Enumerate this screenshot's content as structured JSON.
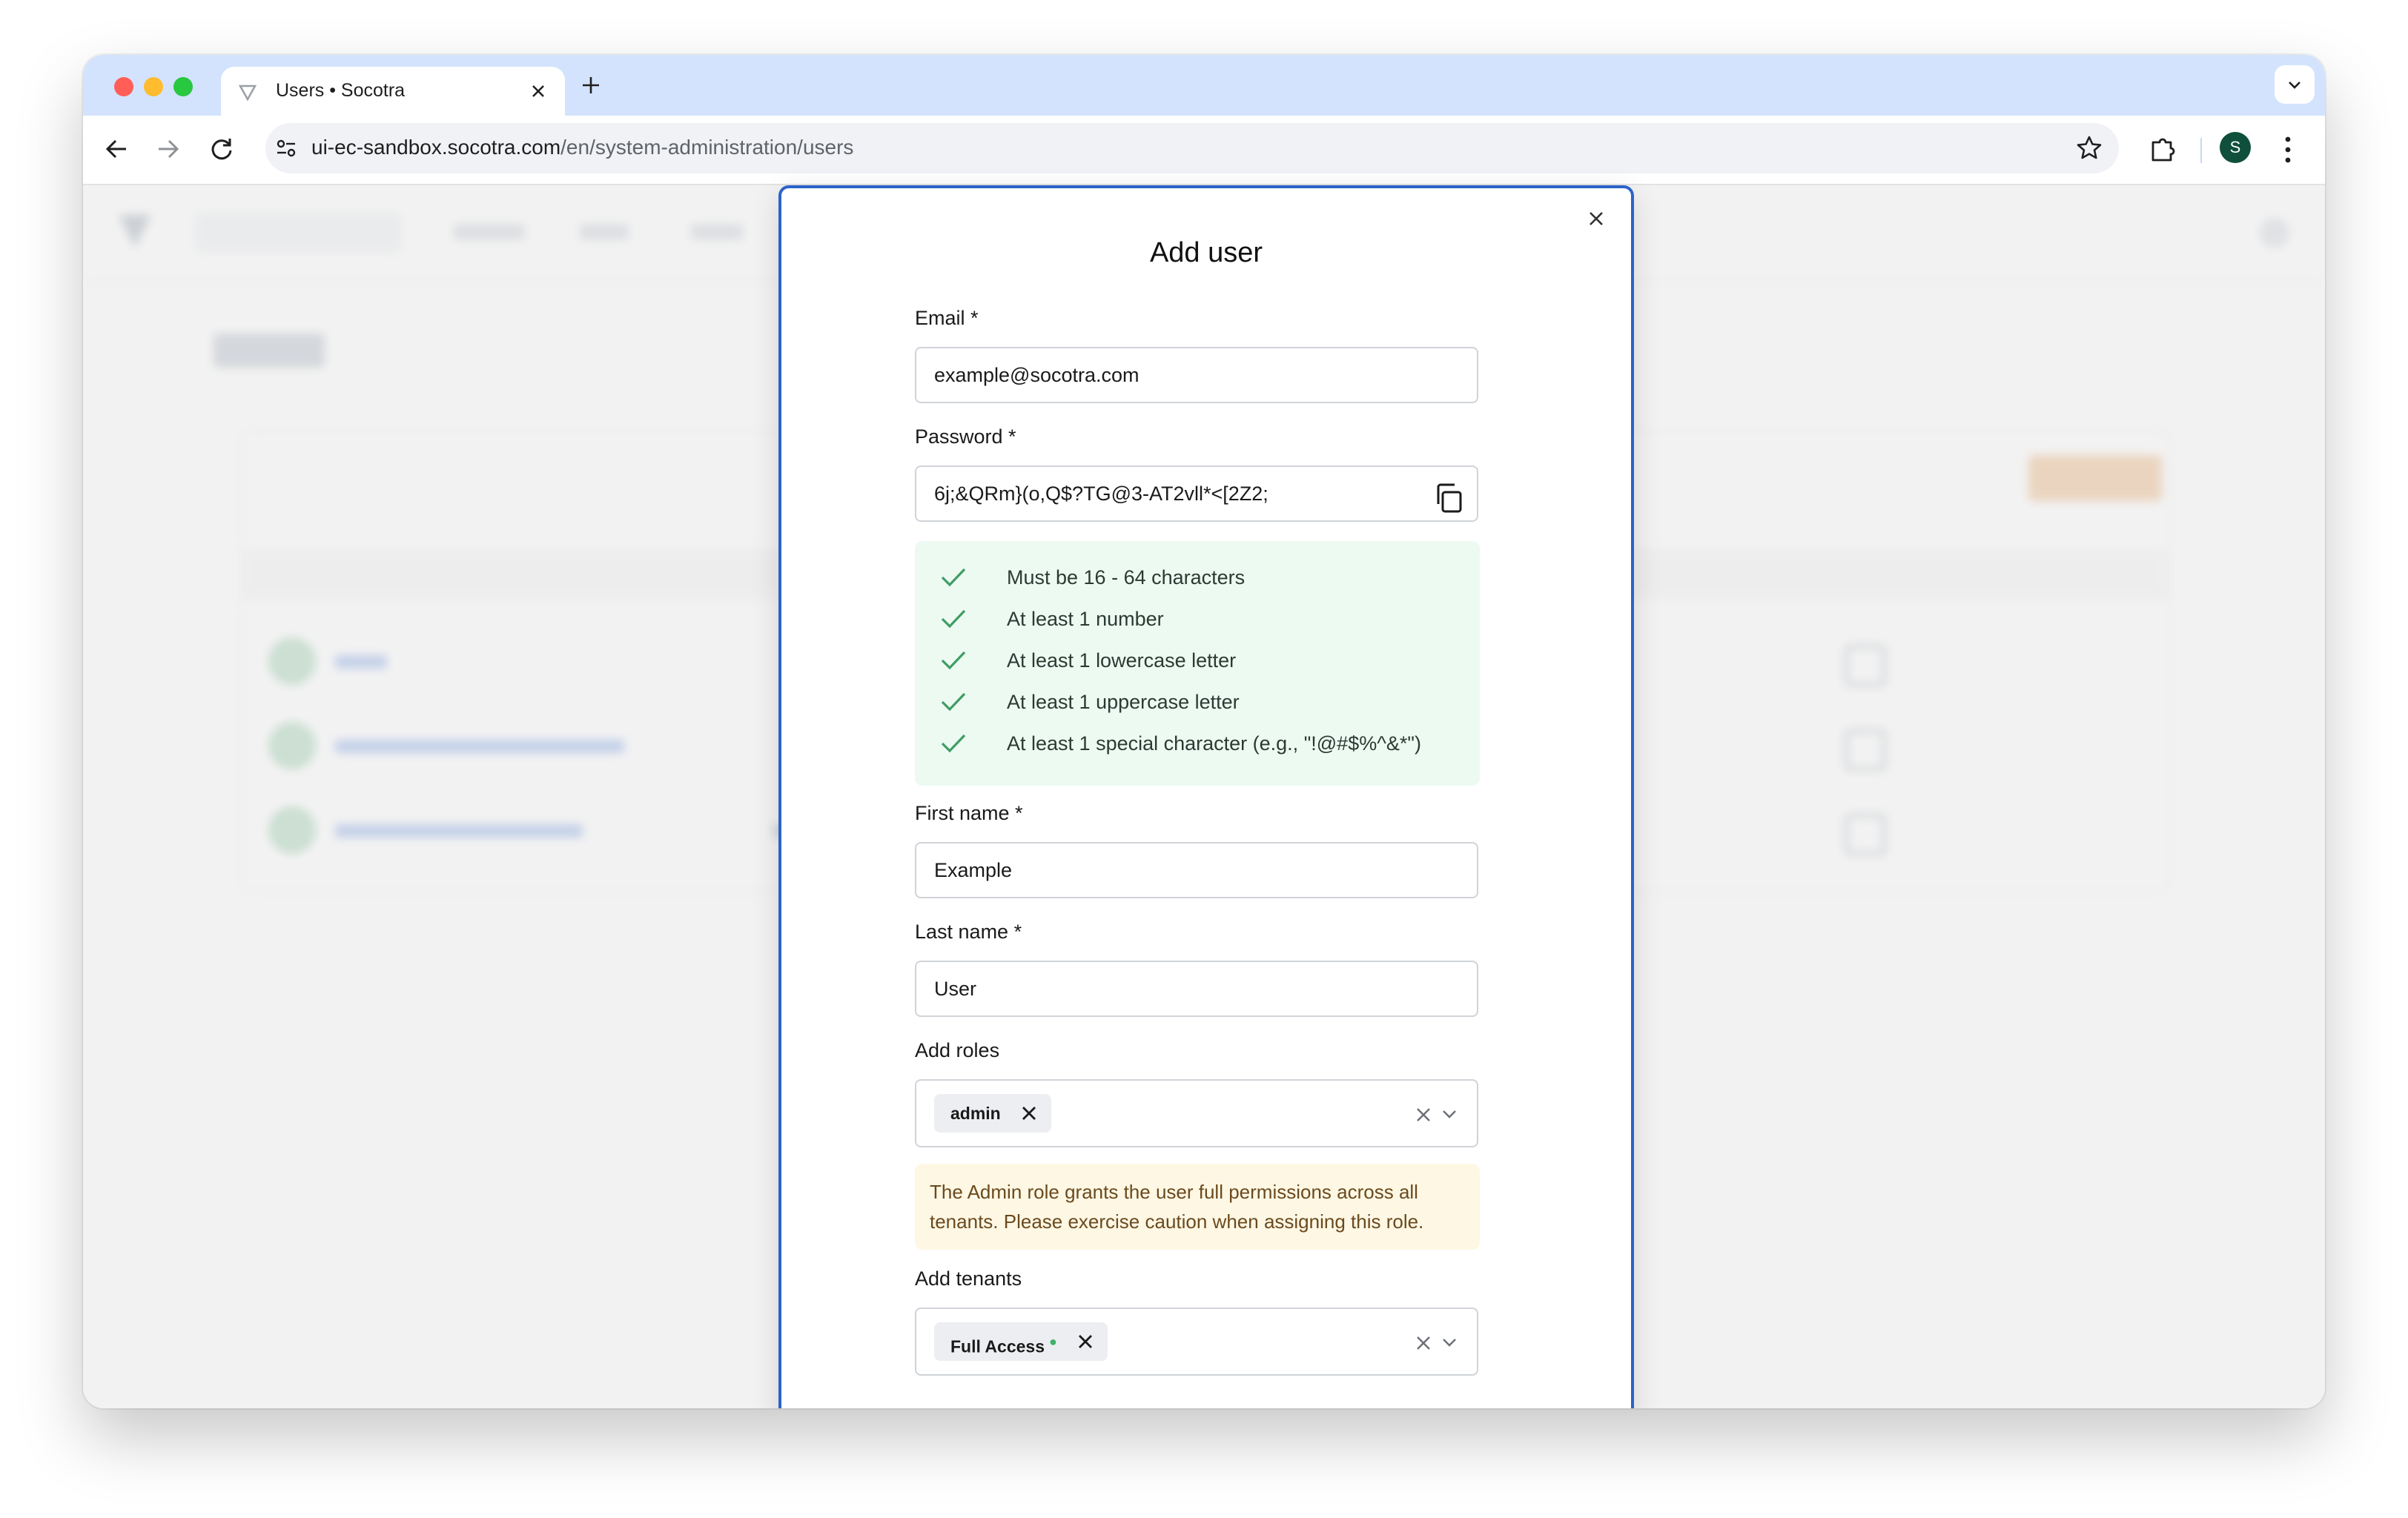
{
  "browser": {
    "tab_title": "Users • Socotra",
    "url_host": "ui-ec-sandbox.socotra.com",
    "url_path": "/en/system-administration/users",
    "profile_initial": "S"
  },
  "modal": {
    "title": "Add user",
    "email": {
      "label": "Email *",
      "value": "example@socotra.com"
    },
    "password": {
      "label": "Password *",
      "value": "6j;&QRm}(o,Q$?TG@3-AT2vll*<[2Z2;"
    },
    "password_rules": [
      "Must be 16 - 64 characters",
      "At least 1 number",
      "At least 1 lowercase letter",
      "At least 1 uppercase letter",
      "At least 1 special character (e.g., \"!@#$%^&*\")"
    ],
    "first_name": {
      "label": "First name *",
      "value": "Example"
    },
    "last_name": {
      "label": "Last name *",
      "value": "User"
    },
    "roles": {
      "label": "Add roles",
      "chips": [
        "admin"
      ]
    },
    "admin_warning": "The Admin role grants the user full permissions across all tenants. Please exercise caution when assigning this role.",
    "tenants": {
      "label": "Add tenants",
      "chips": [
        "Full Access"
      ]
    }
  },
  "colors": {
    "modal_border": "#2b63c9",
    "check_green": "#3f9d63",
    "rules_bg": "#ecfaf2",
    "warning_bg": "#fdf7e4",
    "warning_text": "#6b4a1e"
  }
}
